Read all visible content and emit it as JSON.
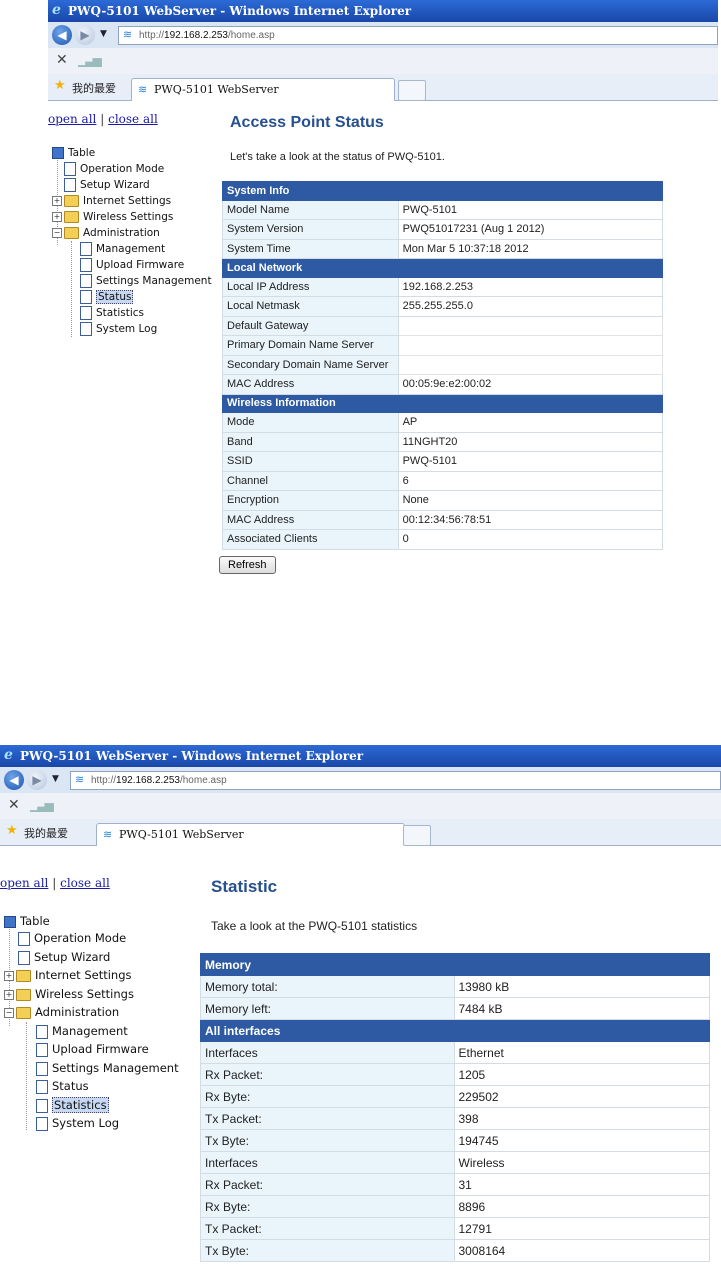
{
  "browser": {
    "window_title": "PWQ-5101 WebServer - Windows Internet Explorer",
    "url_host": "192.168.2.253",
    "url_prefix": "http://",
    "url_path": "/home.asp",
    "favorites_label": "我的最爱",
    "tab_title": "PWQ-5101 WebServer"
  },
  "nav": {
    "open_all": "open all",
    "separator": "|",
    "close_all": "close all",
    "tree": [
      "Table",
      "Operation Mode",
      "Setup Wizard",
      "Internet Settings",
      "Wireless Settings",
      "Administration",
      "Management",
      "Upload Firmware",
      "Settings Management",
      "Status",
      "Statistics",
      "System Log"
    ]
  },
  "status_page": {
    "title": "Access Point Status",
    "intro": "Let's take a look at the status of PWQ-5101.",
    "rows": [
      {
        "type": "header",
        "label": "System Info"
      },
      {
        "label": "Model Name",
        "value": "PWQ-5101"
      },
      {
        "label": "System Version",
        "value": "PWQ51017231 (Aug 1 2012)"
      },
      {
        "label": "System Time",
        "value": "Mon Mar 5 10:37:18 2012"
      },
      {
        "type": "header",
        "label": "Local Network"
      },
      {
        "label": "Local IP Address",
        "value": "192.168.2.253"
      },
      {
        "label": "Local Netmask",
        "value": "255.255.255.0"
      },
      {
        "label": "Default Gateway",
        "value": null
      },
      {
        "label": "Primary Domain Name Server",
        "value": null
      },
      {
        "label": "Secondary Domain Name Server",
        "value": null
      },
      {
        "label": "MAC Address",
        "value": "00:05:9e:e2:00:02"
      },
      {
        "type": "header",
        "label": "Wireless Information"
      },
      {
        "label": "Mode",
        "value": "AP"
      },
      {
        "label": "Band",
        "value": "11NGHT20"
      },
      {
        "label": "SSID",
        "value": "PWQ-5101"
      },
      {
        "label": "Channel",
        "value": "6"
      },
      {
        "label": "Encryption",
        "value": "None"
      },
      {
        "label": "MAC Address",
        "value": "00:12:34:56:78:51"
      },
      {
        "label": "Associated Clients",
        "value": "0"
      }
    ],
    "refresh_label": "Refresh"
  },
  "stats_page": {
    "title": "Statistic",
    "intro": "Take a look at the PWQ-5101 statistics",
    "rows": [
      {
        "type": "header",
        "label": "Memory"
      },
      {
        "label": "Memory total:",
        "value": "13980 kB"
      },
      {
        "label": "Memory left:",
        "value": "7484 kB"
      },
      {
        "type": "header",
        "label": "All interfaces"
      },
      {
        "label": "Interfaces",
        "value": "Ethernet"
      },
      {
        "label": "Rx Packet:",
        "value": "1205"
      },
      {
        "label": "Rx Byte:",
        "value": "229502"
      },
      {
        "label": "Tx Packet:",
        "value": "398"
      },
      {
        "label": "Tx Byte:",
        "value": "194745"
      },
      {
        "label": "Interfaces",
        "value": "Wireless"
      },
      {
        "label": "Rx Packet:",
        "value": "31"
      },
      {
        "label": "Rx Byte:",
        "value": "8896"
      },
      {
        "label": "Tx Packet:",
        "value": "12791"
      },
      {
        "label": "Tx Byte:",
        "value": "3008164"
      }
    ]
  }
}
